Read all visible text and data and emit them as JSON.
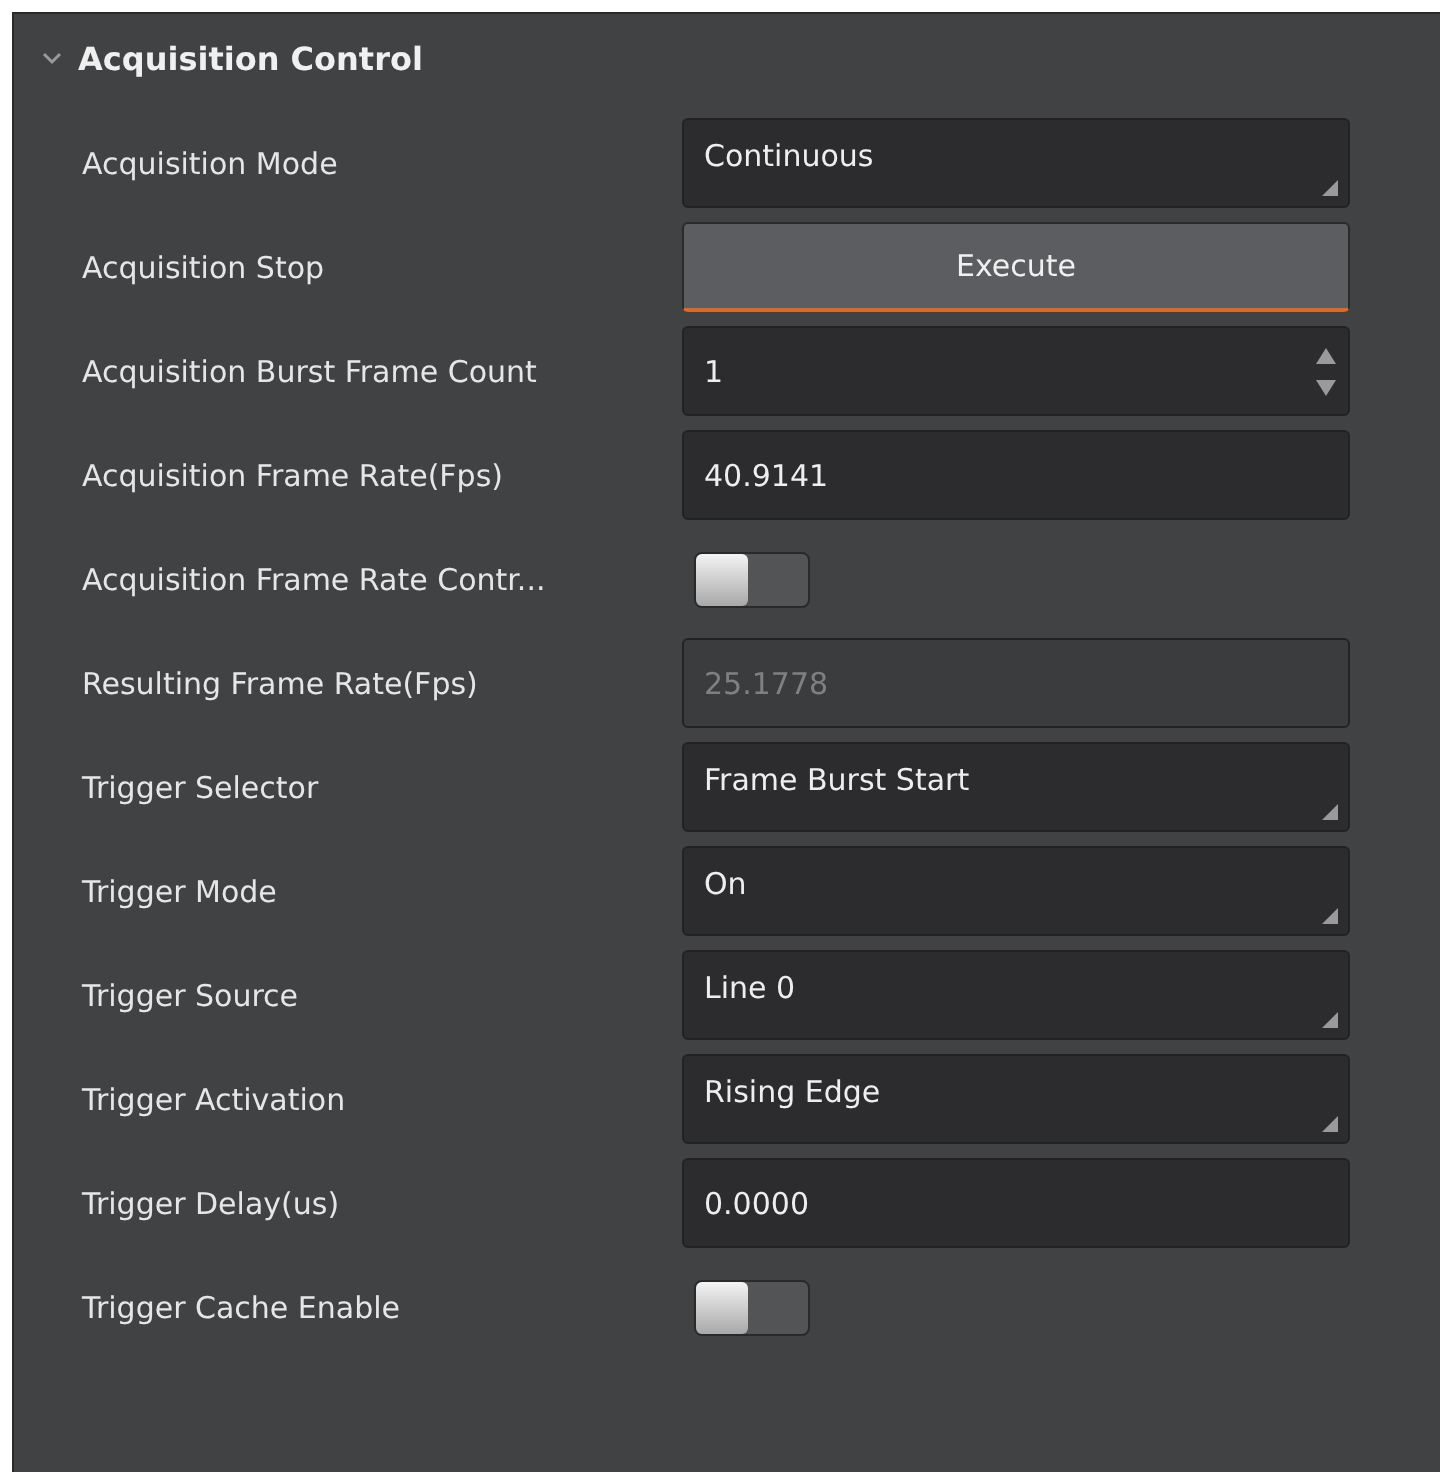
{
  "section": {
    "title": "Acquisition Control",
    "expanded": true
  },
  "rows": [
    {
      "label": "Acquisition Mode",
      "kind": "combo",
      "value": "Continuous",
      "disabled": false
    },
    {
      "label": "Acquisition Stop",
      "kind": "button",
      "value": "Execute",
      "disabled": false
    },
    {
      "label": "Acquisition Burst Frame Count",
      "kind": "spin",
      "value": "1",
      "disabled": false
    },
    {
      "label": "Acquisition Frame Rate(Fps)",
      "kind": "number",
      "value": "40.9141",
      "disabled": false
    },
    {
      "label": "Acquisition Frame Rate Contr...",
      "kind": "switch",
      "on": false,
      "disabled": false
    },
    {
      "label": "Resulting Frame Rate(Fps)",
      "kind": "number",
      "value": "25.1778",
      "disabled": true
    },
    {
      "label": "Trigger Selector",
      "kind": "combo",
      "value": "Frame Burst Start",
      "disabled": false
    },
    {
      "label": "Trigger Mode",
      "kind": "combo",
      "value": "On",
      "disabled": false
    },
    {
      "label": "Trigger Source",
      "kind": "combo",
      "value": "Line 0",
      "disabled": false
    },
    {
      "label": "Trigger Activation",
      "kind": "combo",
      "value": "Rising Edge",
      "disabled": false
    },
    {
      "label": "Trigger Delay(us)",
      "kind": "number",
      "value": "0.0000",
      "disabled": false
    },
    {
      "label": "Trigger Cache Enable",
      "kind": "switch",
      "on": false,
      "disabled": false
    }
  ]
}
